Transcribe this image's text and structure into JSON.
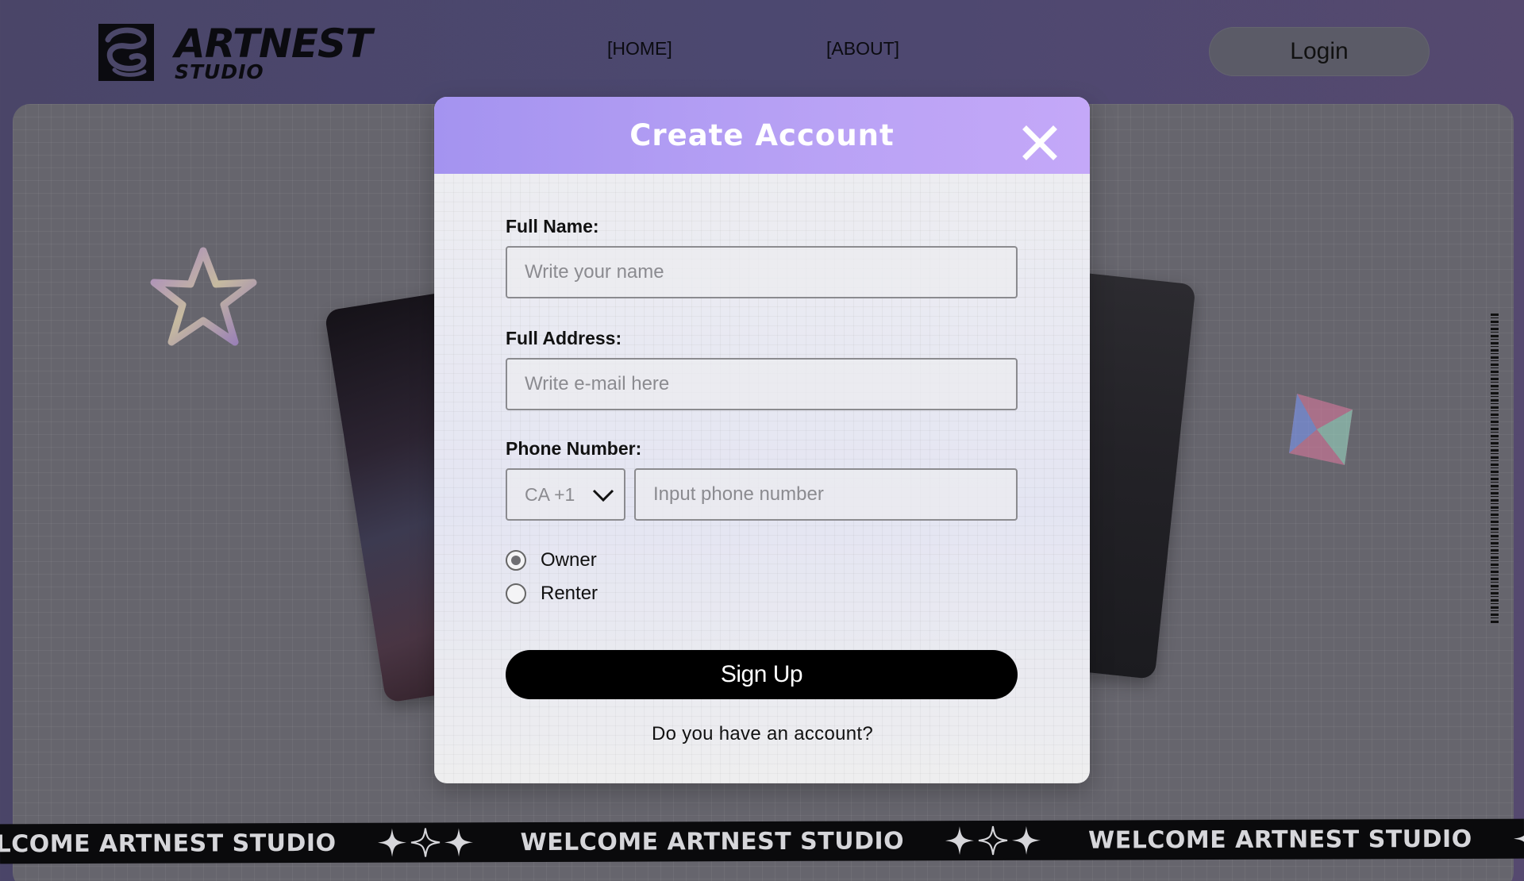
{
  "header": {
    "logo_main": "ARTNEST",
    "logo_sub": "STUDIO",
    "nav": [
      {
        "label": "[HOME]"
      },
      {
        "label": "[ABOUT]"
      }
    ],
    "login_label": "Login"
  },
  "marquee": {
    "text": "WELCOME ARTNEST STUDIO",
    "star_icon": "four-point-star-icon"
  },
  "modal": {
    "title": "Create Account",
    "close_icon": "close-icon",
    "full_name": {
      "label": "Full Name:",
      "placeholder": "Write your name",
      "value": ""
    },
    "full_address": {
      "label": "Full Address:",
      "placeholder": "Write e-mail here",
      "value": ""
    },
    "phone": {
      "label": "Phone Number:",
      "country_value": "CA +1",
      "placeholder": "Input phone number",
      "value": ""
    },
    "role_options": [
      {
        "label": "Owner",
        "checked": true
      },
      {
        "label": "Renter",
        "checked": false
      }
    ],
    "signup_label": "Sign Up",
    "account_prompt": "Do you have an account?"
  },
  "colors": {
    "page_bg": "#4b4769",
    "modal_header": "#b19bf4",
    "signup_bg": "#000000",
    "login_bg": "#5b5b67"
  }
}
